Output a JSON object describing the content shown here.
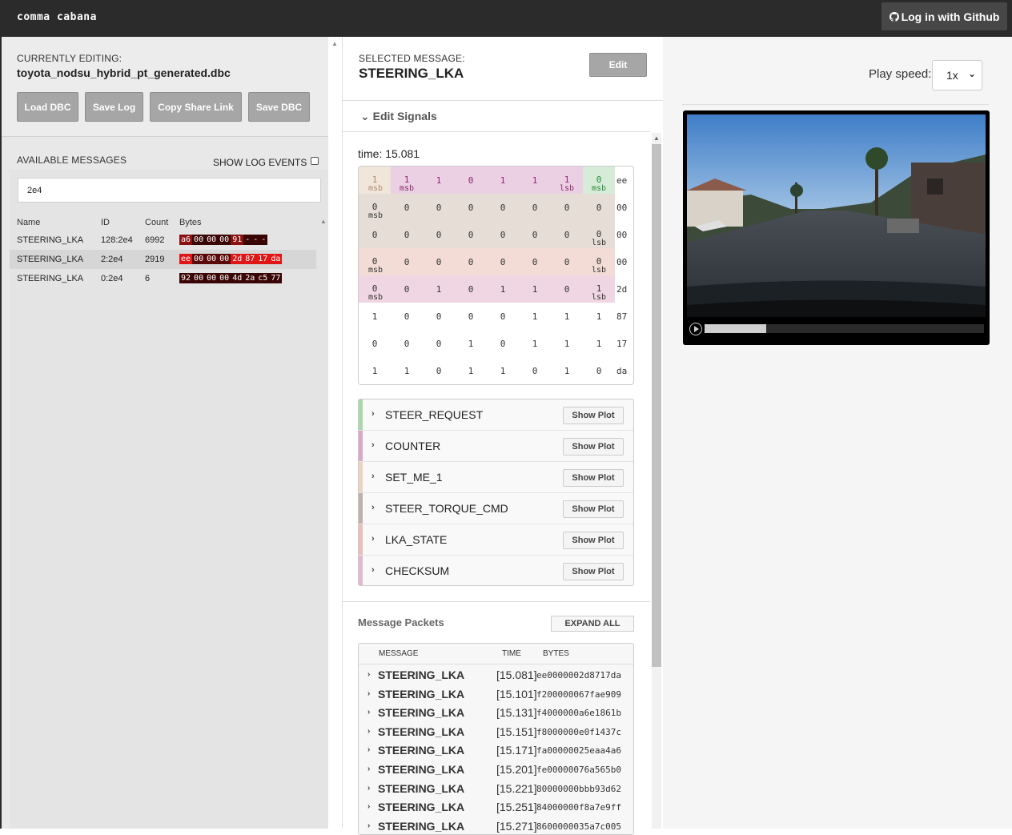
{
  "header": {
    "brand": "comma cabana",
    "login_label": "Log in with Github"
  },
  "left": {
    "currently_editing_label": "CURRENTLY EDITING:",
    "dbc_name": "toyota_nodsu_hybrid_pt_generated.dbc",
    "buttons": [
      "Load DBC",
      "Save Log",
      "Copy Share Link",
      "Save DBC"
    ],
    "available_messages_label": "AVAILABLE MESSAGES",
    "show_log_events_label": "SHOW LOG EVENTS",
    "show_log_events_checked": false,
    "search_value": "2e4",
    "table_headers": [
      "Name",
      "ID",
      "Count",
      "Bytes"
    ],
    "messages": [
      {
        "name": "STEERING_LKA",
        "id": "128:2e4",
        "count": "6992",
        "bytes": [
          "a6",
          "00",
          "00",
          "00",
          "91",
          "-",
          "-",
          "-"
        ],
        "byte_colors": [
          "#8b1111",
          "#3a0505",
          "#3a0505",
          "#3a0505",
          "#8b1111",
          "#3a0505",
          "#3a0505",
          "#3a0505"
        ],
        "selected": false
      },
      {
        "name": "STEERING_LKA",
        "id": "2:2e4",
        "count": "2919",
        "bytes": [
          "ee",
          "00",
          "00",
          "00",
          "2d",
          "87",
          "17",
          "da"
        ],
        "byte_colors": [
          "#e01515",
          "#5a0808",
          "#5a0808",
          "#5a0808",
          "#e01515",
          "#e01515",
          "#e01515",
          "#e01515"
        ],
        "selected": true
      },
      {
        "name": "STEERING_LKA",
        "id": "0:2e4",
        "count": "6",
        "bytes": [
          "92",
          "00",
          "00",
          "00",
          "4d",
          "2a",
          "c5",
          "77"
        ],
        "byte_colors": [
          "#3a0505",
          "#3a0505",
          "#3a0505",
          "#3a0505",
          "#3a0505",
          "#3a0505",
          "#3a0505",
          "#3a0505"
        ],
        "selected": false
      }
    ]
  },
  "middle": {
    "selected_message_label": "SELECTED MESSAGE:",
    "selected_message": "STEERING_LKA",
    "edit_label": "Edit",
    "edit_signals_label": "Edit Signals",
    "time_label": "time: 15.081",
    "bit_grid": [
      {
        "hex": "ee",
        "bits": [
          "1",
          "1",
          "1",
          "0",
          "1",
          "1",
          "1",
          "0"
        ],
        "tags": [
          "msb",
          "msb",
          "",
          "",
          "",
          "",
          "lsb",
          "msb"
        ],
        "colors": [
          "#f1e6da",
          "#ebd0e4",
          "#ebd0e4",
          "#ebd0e4",
          "#ebd0e4",
          "#ebd0e4",
          "#ebd0e4",
          "#d6ecd8"
        ]
      },
      {
        "hex": "00",
        "bits": [
          "0",
          "0",
          "0",
          "0",
          "0",
          "0",
          "0",
          "0"
        ],
        "tags": [
          "msb",
          "",
          "",
          "",
          "",
          "",
          "",
          ""
        ],
        "colors": [
          "#e6ddd6",
          "#e6ddd6",
          "#e6ddd6",
          "#e6ddd6",
          "#e6ddd6",
          "#e6ddd6",
          "#e6ddd6",
          "#e6ddd6"
        ]
      },
      {
        "hex": "00",
        "bits": [
          "0",
          "0",
          "0",
          "0",
          "0",
          "0",
          "0",
          "0"
        ],
        "tags": [
          "",
          "",
          "",
          "",
          "",
          "",
          "",
          "lsb"
        ],
        "colors": [
          "#e6ddd6",
          "#e6ddd6",
          "#e6ddd6",
          "#e6ddd6",
          "#e6ddd6",
          "#e6ddd6",
          "#e6ddd6",
          "#e6ddd6"
        ]
      },
      {
        "hex": "00",
        "bits": [
          "0",
          "0",
          "0",
          "0",
          "0",
          "0",
          "0",
          "0"
        ],
        "tags": [
          "msb",
          "",
          "",
          "",
          "",
          "",
          "",
          "lsb"
        ],
        "colors": [
          "#f3dcd6",
          "#f3dcd6",
          "#f3dcd6",
          "#f3dcd6",
          "#f3dcd6",
          "#f3dcd6",
          "#f3dcd6",
          "#f3dcd6"
        ]
      },
      {
        "hex": "2d",
        "bits": [
          "0",
          "0",
          "1",
          "0",
          "1",
          "1",
          "0",
          "1"
        ],
        "tags": [
          "msb",
          "",
          "",
          "",
          "",
          "",
          "",
          "lsb"
        ],
        "colors": [
          "#f0d6e2",
          "#f0d6e2",
          "#f0d6e2",
          "#f0d6e2",
          "#f0d6e2",
          "#f0d6e2",
          "#f0d6e2",
          "#f0d6e2"
        ]
      },
      {
        "hex": "87",
        "bits": [
          "1",
          "0",
          "0",
          "0",
          "0",
          "1",
          "1",
          "1"
        ],
        "tags": [
          "",
          "",
          "",
          "",
          "",
          "",
          "",
          ""
        ],
        "colors": [
          "#fff",
          "#fff",
          "#fff",
          "#fff",
          "#fff",
          "#fff",
          "#fff",
          "#fff"
        ]
      },
      {
        "hex": "17",
        "bits": [
          "0",
          "0",
          "0",
          "1",
          "0",
          "1",
          "1",
          "1"
        ],
        "tags": [
          "",
          "",
          "",
          "",
          "",
          "",
          "",
          ""
        ],
        "colors": [
          "#fff",
          "#fff",
          "#fff",
          "#fff",
          "#fff",
          "#fff",
          "#fff",
          "#fff"
        ]
      },
      {
        "hex": "da",
        "bits": [
          "1",
          "1",
          "0",
          "1",
          "1",
          "0",
          "1",
          "0"
        ],
        "tags": [
          "",
          "",
          "",
          "",
          "",
          "",
          "",
          ""
        ],
        "colors": [
          "#fff",
          "#fff",
          "#fff",
          "#fff",
          "#fff",
          "#fff",
          "#fff",
          "#fff"
        ]
      }
    ],
    "signals": [
      {
        "name": "STEER_REQUEST",
        "color": "#a9d8a9",
        "plot_label": "Show Plot"
      },
      {
        "name": "COUNTER",
        "color": "#d9a8c9",
        "plot_label": "Show Plot"
      },
      {
        "name": "SET_ME_1",
        "color": "#e8d4c0",
        "plot_label": "Show Plot"
      },
      {
        "name": "STEER_TORQUE_CMD",
        "color": "#bfb0a8",
        "plot_label": "Show Plot"
      },
      {
        "name": "LKA_STATE",
        "color": "#e8c0b8",
        "plot_label": "Show Plot"
      },
      {
        "name": "CHECKSUM",
        "color": "#e0b8d0",
        "plot_label": "Show Plot"
      }
    ],
    "message_packets_label": "Message Packets",
    "expand_all_label": "EXPAND ALL",
    "packet_headers": [
      "MESSAGE",
      "TIME",
      "BYTES"
    ],
    "packets": [
      {
        "name": "STEERING_LKA",
        "time": "[15.081]",
        "bytes": "ee0000002d8717da"
      },
      {
        "name": "STEERING_LKA",
        "time": "[15.101]",
        "bytes": "f200000067fae909"
      },
      {
        "name": "STEERING_LKA",
        "time": "[15.131]",
        "bytes": "f4000000a6e1861b"
      },
      {
        "name": "STEERING_LKA",
        "time": "[15.151]",
        "bytes": "f8000000e0f1437c"
      },
      {
        "name": "STEERING_LKA",
        "time": "[15.171]",
        "bytes": "fa00000025eaa4a6"
      },
      {
        "name": "STEERING_LKA",
        "time": "[15.201]",
        "bytes": "fe00000076a565b0"
      },
      {
        "name": "STEERING_LKA",
        "time": "[15.221]",
        "bytes": "80000000bbb93d62"
      },
      {
        "name": "STEERING_LKA",
        "time": "[15.251]",
        "bytes": "84000000f8a7e9ff"
      },
      {
        "name": "STEERING_LKA",
        "time": "[15.271]",
        "bytes": "8600000035a7c005"
      }
    ]
  },
  "right": {
    "play_speed_label": "Play speed:",
    "play_speed_value": "1x",
    "video_progress": 0.22
  }
}
